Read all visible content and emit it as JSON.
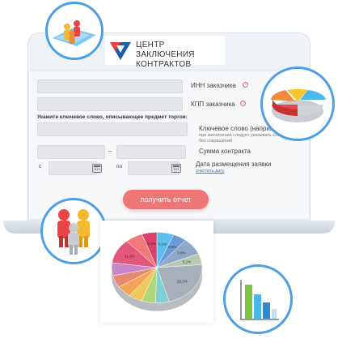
{
  "logo": {
    "line1": "ЦЕНТР ЗАКЛЮЧЕНИЯ",
    "line2": "КОНТРАКТОВ"
  },
  "form": {
    "inn_label": "ИНН заказчика",
    "kpp_label": "КПП заказчика",
    "keyword_title": "Укажите ключевое слово, описывающее предмет торгов:",
    "keyword_label": "Ключевое слово (например",
    "keyword_hint_1": "при заполнении следует указывать сло",
    "keyword_hint_2": "без сокращений",
    "sum_label": "Сумма контракта",
    "sum_dash": "–",
    "date_from": "с",
    "date_to": "по",
    "date_label": "Дата размещения заявки",
    "clear_date": "очистить дату",
    "help_glyph": "?",
    "submit_label": "получить отчет"
  },
  "chart_data": {
    "type": "pie",
    "slices": [
      {
        "label": "6,1%",
        "value": 6.1,
        "color": "#5bc0f0"
      },
      {
        "label": "4,9%",
        "value": 4.9,
        "color": "#6b9bd6"
      },
      {
        "label": "7,8%",
        "value": 7.8,
        "color": "#8fa8c8"
      },
      {
        "label": "5,1%",
        "value": 5.1,
        "color": "#b7c9b0"
      },
      {
        "label": "22,1%",
        "value": 22.1,
        "color": "#a7b0b8"
      },
      {
        "label": "",
        "value": 5.0,
        "color": "#7fd0d4"
      },
      {
        "label": "",
        "value": 5.0,
        "color": "#b0d67a"
      },
      {
        "label": "",
        "value": 5.0,
        "color": "#f0c75a"
      },
      {
        "label": "",
        "value": 5.5,
        "color": "#f3a65a"
      },
      {
        "label": "",
        "value": 5.5,
        "color": "#e58a6f"
      },
      {
        "label": "",
        "value": 6.0,
        "color": "#c987c9"
      },
      {
        "label": "11,3%",
        "value": 11.3,
        "color": "#e2577a"
      },
      {
        "label": "",
        "value": 6.3,
        "color": "#f07a7a"
      },
      {
        "label": "5,4%",
        "value": 5.4,
        "color": "#d8416a"
      }
    ]
  },
  "colors": {
    "accent": "#ef7674",
    "ring": "#4d9fe3",
    "field": "#e4e6e9"
  }
}
